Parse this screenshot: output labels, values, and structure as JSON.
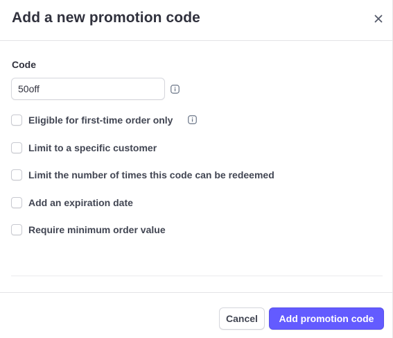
{
  "header": {
    "title": "Add a new promotion code",
    "close_icon": "close-icon"
  },
  "code": {
    "label": "Code",
    "value": "50off",
    "placeholder": "",
    "info_icon": "info-icon"
  },
  "options": [
    {
      "label": "Eligible for first-time order only",
      "checked": false,
      "has_info": true
    },
    {
      "label": "Limit to a specific customer",
      "checked": false
    },
    {
      "label": "Limit the number of times this code can be redeemed",
      "checked": false
    },
    {
      "label": "Add an expiration date",
      "checked": false
    },
    {
      "label": "Require minimum order value",
      "checked": false
    }
  ],
  "footer": {
    "cancel_label": "Cancel",
    "submit_label": "Add promotion code"
  },
  "colors": {
    "accent": "#635bff",
    "text": "#30313d",
    "border": "#d5d6dc"
  }
}
